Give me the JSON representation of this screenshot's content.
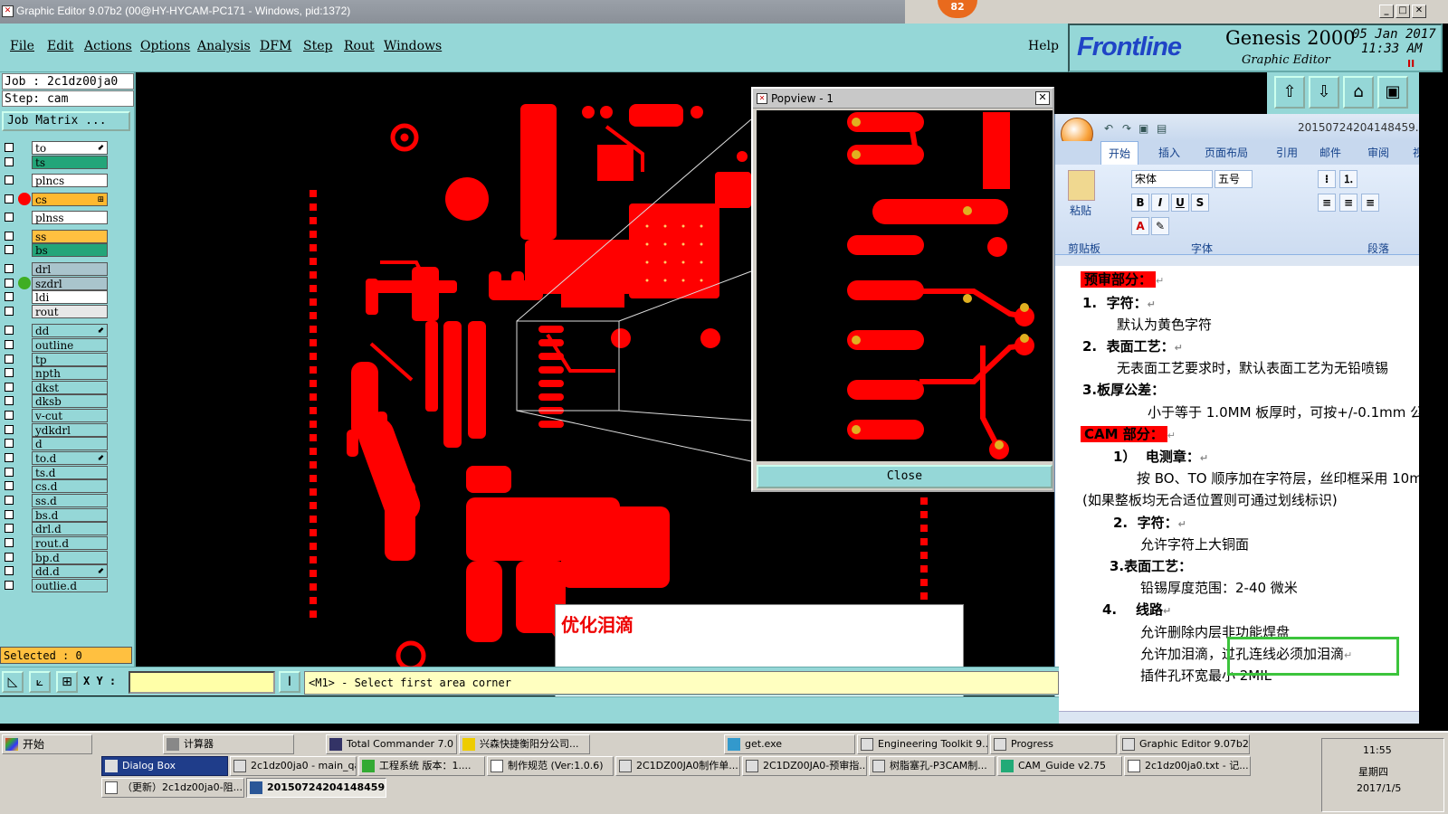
{
  "window": {
    "title": "Graphic Editor 9.07b2 (00@HY-HYCAM-PC171 - Windows, pid:1372)",
    "badge": "82"
  },
  "menu": {
    "file": "File",
    "edit": "Edit",
    "actions": "Actions",
    "options": "Options",
    "analysis": "Analysis",
    "dfm": "DFM",
    "step": "Step",
    "rout": "Rout",
    "windows": "Windows",
    "help": "Help"
  },
  "brand": {
    "logo": "Frontline",
    "product": "Genesis 2000",
    "subtitle": "Graphic Editor",
    "date": "05 Jan 2017",
    "time": "11:33 AM",
    "pause": "II"
  },
  "left": {
    "job": "Job : 2c1dz00ja0",
    "step": "Step: cam",
    "job_matrix": "Job Matrix ...",
    "selected": "Selected : 0",
    "layers": [
      {
        "name": "to",
        "color": "#ffffff",
        "mark": "⬋"
      },
      {
        "name": "ts",
        "color": "#23a579",
        "mark": ""
      },
      {
        "name": "plncs",
        "color": "#ffffff",
        "mark": ""
      },
      {
        "name": "cs",
        "color": "#ffb930",
        "mark": "⊞",
        "dot": "#ff0000"
      },
      {
        "name": "plnss",
        "color": "#ffffff",
        "mark": ""
      },
      {
        "name": "ss",
        "color": "#ffc040",
        "mark": ""
      },
      {
        "name": "bs",
        "color": "#23a579",
        "mark": ""
      },
      {
        "name": "drl",
        "color": "#a9c4cc",
        "mark": ""
      },
      {
        "name": "szdrl",
        "color": "#a9c4cc",
        "mark": "",
        "dot": "#3fae23"
      },
      {
        "name": "ldi",
        "color": "#ffffff",
        "mark": ""
      },
      {
        "name": "rout",
        "color": "#e8e8e8",
        "mark": ""
      },
      {
        "name": "dd",
        "color": "#95d7d7",
        "mark": "⬋"
      },
      {
        "name": "outline",
        "color": "#95d7d7",
        "mark": ""
      },
      {
        "name": "tp",
        "color": "#95d7d7",
        "mark": ""
      },
      {
        "name": "npth",
        "color": "#95d7d7",
        "mark": ""
      },
      {
        "name": "dkst",
        "color": "#95d7d7",
        "mark": ""
      },
      {
        "name": "dksb",
        "color": "#95d7d7",
        "mark": ""
      },
      {
        "name": "v-cut",
        "color": "#95d7d7",
        "mark": ""
      },
      {
        "name": "ydkdrl",
        "color": "#95d7d7",
        "mark": ""
      },
      {
        "name": "d",
        "color": "#95d7d7",
        "mark": ""
      },
      {
        "name": "to.d",
        "color": "#95d7d7",
        "mark": "⬋"
      },
      {
        "name": "ts.d",
        "color": "#95d7d7",
        "mark": ""
      },
      {
        "name": "cs.d",
        "color": "#95d7d7",
        "mark": ""
      },
      {
        "name": "ss.d",
        "color": "#95d7d7",
        "mark": ""
      },
      {
        "name": "bs.d",
        "color": "#95d7d7",
        "mark": ""
      },
      {
        "name": "drl.d",
        "color": "#95d7d7",
        "mark": ""
      },
      {
        "name": "rout.d",
        "color": "#95d7d7",
        "mark": ""
      },
      {
        "name": "bp.d",
        "color": "#95d7d7",
        "mark": ""
      },
      {
        "name": "dd.d",
        "color": "#95d7d7",
        "mark": "⬋"
      },
      {
        "name": "outlie.d",
        "color": "#95d7d7",
        "mark": ""
      }
    ]
  },
  "bottom": {
    "xy_label": "X Y :",
    "prompt": "<M1> - Select first area corner"
  },
  "popview": {
    "title": "Popview - 1",
    "close": "Close"
  },
  "note": {
    "text": "优化泪滴"
  },
  "word": {
    "filename": "20150724204148459.rtf",
    "tabs": [
      "开始",
      "插入",
      "页面布局",
      "引用",
      "邮件",
      "审阅",
      "视"
    ],
    "font_name": "宋体",
    "font_size": "五号",
    "groups": {
      "clipboard": "剪贴板",
      "font": "字体",
      "paragraph": "段落",
      "paste": "粘贴"
    },
    "lines": {
      "l1": "预审部分：",
      "l2n": "1.",
      "l2": "字符：",
      "l3": "默认为黄色字符",
      "l4n": "2.",
      "l4": "表面工艺：",
      "l5": "无表面工艺要求时，默认表面工艺为无铅喷锡",
      "l6": "3.板厚公差：",
      "l7": "小于等于 1.0MM 板厚时，可按+/-0.1mm 公",
      "l8": "CAM 部分：",
      "l9n": "1）",
      "l9": "电测章：",
      "l10": "按 BO、TO 顺序加在字符层，丝印框采用 10m",
      "l11": "(如果整板均无合适位置则可通过划线标识)",
      "l12n": "2.",
      "l12": "字符：",
      "l13": "允许字符上大铜面",
      "l14": "3.表面工艺：",
      "l15": "铅锡厚度范围：2-40 微米",
      "l16n": "4.",
      "l16": "线路",
      "l17": "允许删除内层非功能焊盘",
      "l18a": "允许加泪滴，",
      "l18b": "过孔连线必须加泪滴",
      "l19": "插件孔环宽最小 2MIL"
    }
  },
  "taskbar": {
    "start": "开始",
    "row1": [
      "计算器",
      "Total Commander 7.0 ...",
      "兴森快捷衡阳分公司...",
      "get.exe",
      "Engineering Toolkit 9....",
      "Progress",
      "Graphic Editor 9.07b2 ..."
    ],
    "row2": [
      "Dialog Box",
      "2c1dz00ja0 - main_qa",
      "工程系统  版本：1....",
      "制作规范 (Ver:1.0.6)",
      "2C1DZ00JA0制作单....",
      "2C1DZ00JA0-预审指...",
      "树脂塞孔-P3CAM制...",
      "CAM_Guide v2.75",
      "2c1dz00ja0.txt - 记..."
    ],
    "row3": [
      "（更新）2c1dz00ja0-阻...",
      "20150724204148459...."
    ],
    "clock": {
      "time": "11:55",
      "day": "星期四",
      "date": "2017/1/5"
    }
  }
}
